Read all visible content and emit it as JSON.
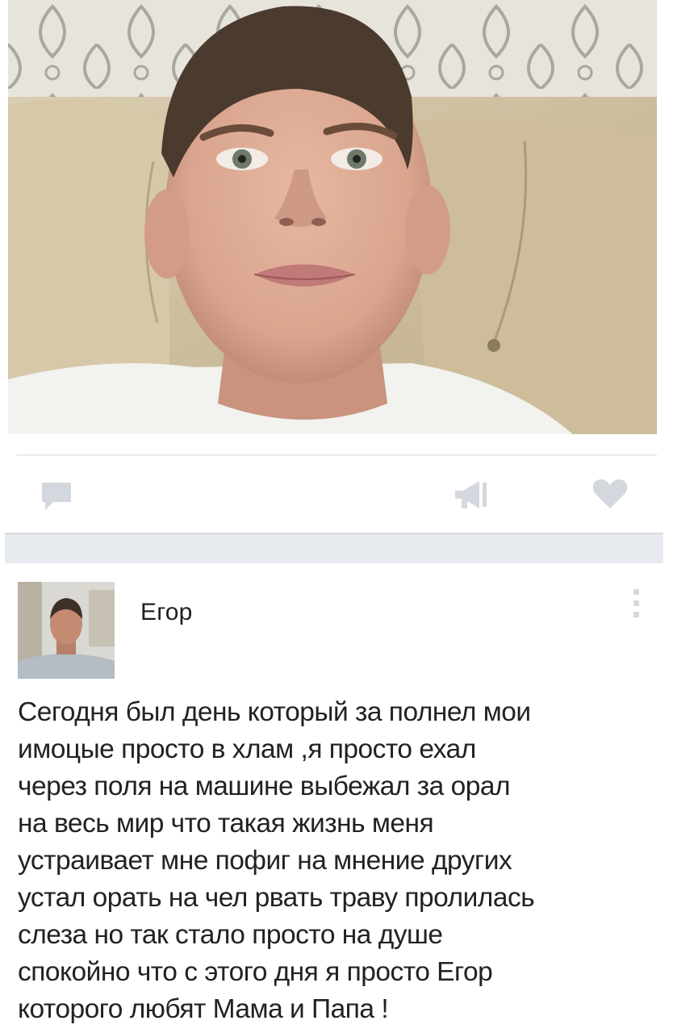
{
  "photo": {
    "icon": "selfie-photo"
  },
  "actions": {
    "comment_icon": "comment-icon",
    "share_icon": "megaphone-share-icon",
    "like_icon": "heart-icon"
  },
  "post": {
    "author_name": "Егор",
    "avatar_icon": "avatar",
    "menu_icon": "more-vertical-icon",
    "text": "Сегодня был день который за полнел мои\nимоцые просто в хлам ,я просто ехал\nчерез поля на машине выбежал за орал\nна весь мир что такая жизнь меня\nустраивает мне пофиг на мнение других\nустал орать на чел рвать траву пролилась\nслеза но так стало просто на душе\nспокойно что с этого дня я просто Егор\nкоторого любят Мама и Папа !"
  },
  "colors": {
    "icon_gray": "#d3d8de",
    "band": "#e7eaee",
    "text": "#222222"
  }
}
